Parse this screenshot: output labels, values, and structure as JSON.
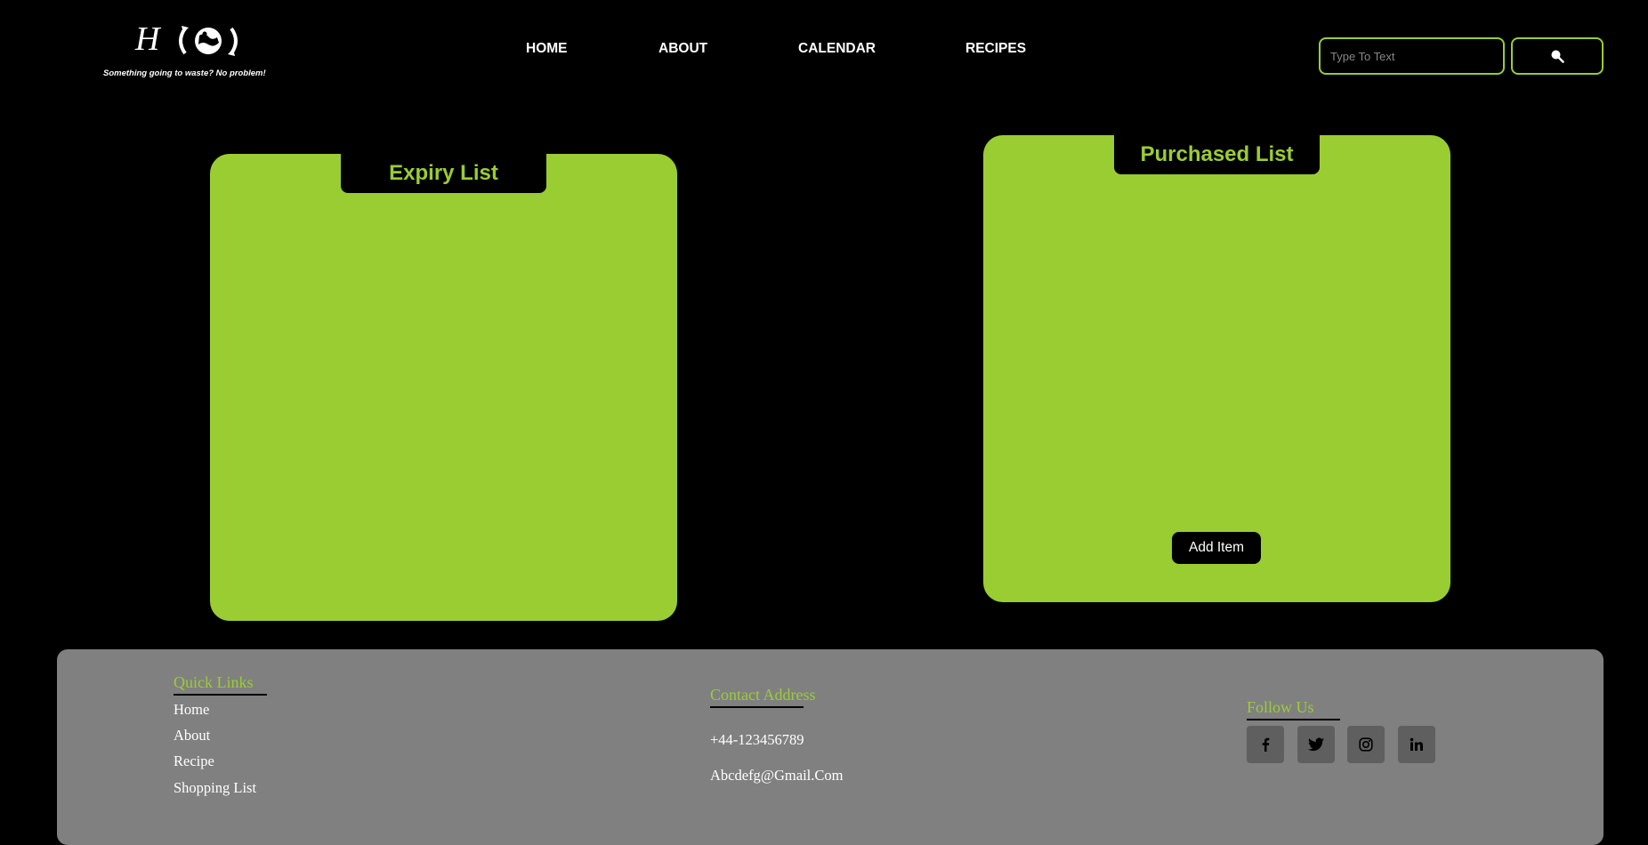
{
  "header": {
    "logo_letter": "H",
    "tagline": "Something going to waste? No problem!",
    "nav": [
      "HOME",
      "ABOUT",
      "CALENDAR",
      "RECIPES"
    ],
    "search_placeholder": "Type To Text",
    "search_icon": "search-icon"
  },
  "panels": {
    "expiry_title": "Expiry List",
    "purchased_title": "Purchased List",
    "add_item_label": "Add Item"
  },
  "footer": {
    "quick_links_title": "Quick Links",
    "quick_links": [
      "Home",
      "About",
      "Recipe",
      "Shopping List"
    ],
    "contact_title": "Contact Address",
    "phone": "+44-123456789",
    "email": "Abcdefg@Gmail.Com",
    "follow_title": "Follow Us",
    "social_icons": [
      "facebook-icon",
      "twitter-icon",
      "instagram-icon",
      "linkedin-icon"
    ]
  },
  "colors": {
    "accent": "#9acd32",
    "background": "#000000",
    "footer": "#808080",
    "social_bg": "#5f5f5f"
  }
}
